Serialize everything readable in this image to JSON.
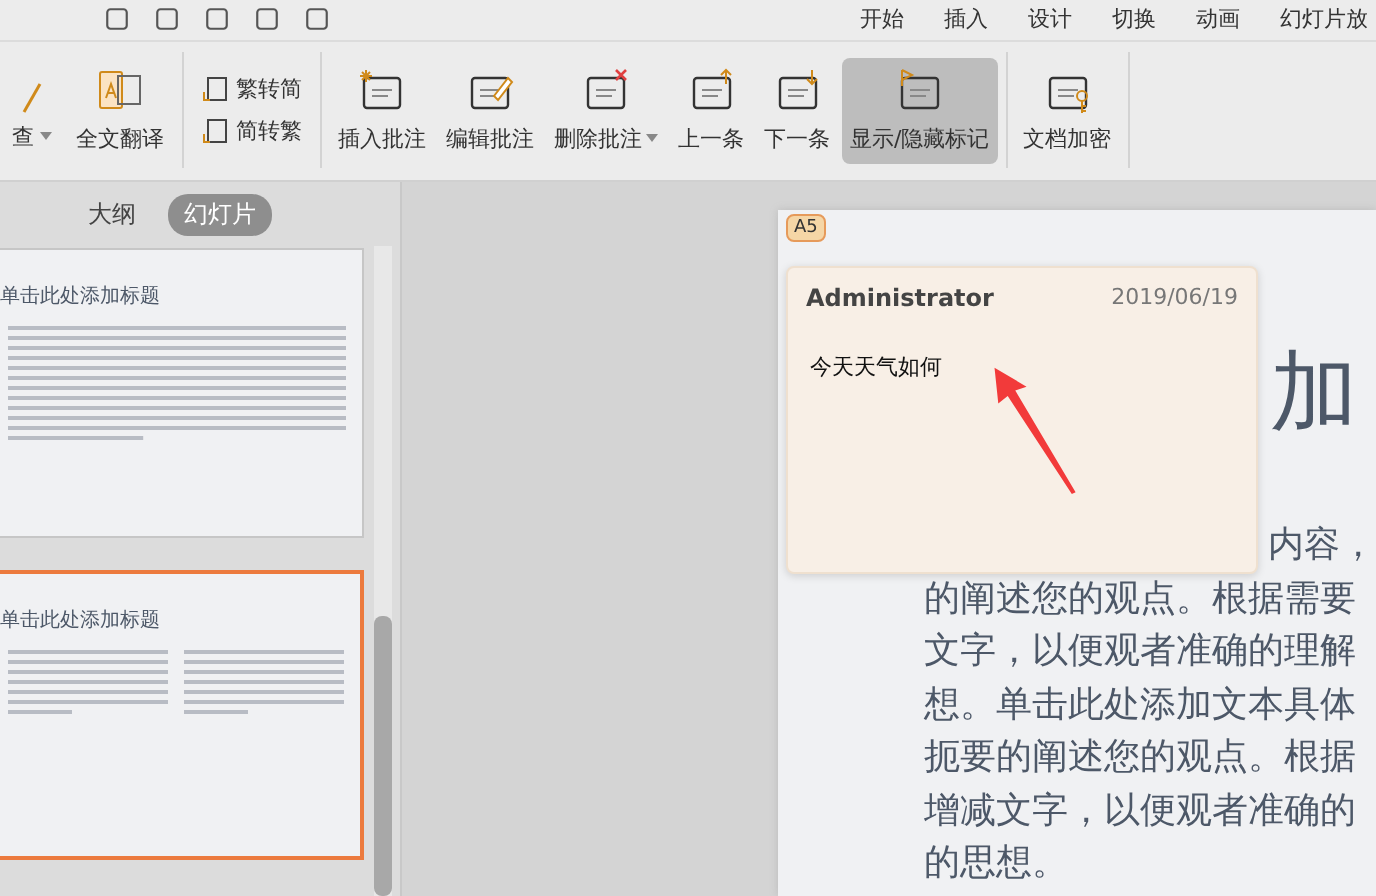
{
  "menu_tabs": [
    "开始",
    "插入",
    "设计",
    "切换",
    "动画",
    "幻灯片放"
  ],
  "ribbon": {
    "left_label": "查",
    "translate": "全文翻译",
    "convert": [
      "繁转简",
      "简转繁"
    ],
    "tools": [
      {
        "label": "插入批注",
        "kind": "insert",
        "selected": false,
        "dropdown": false
      },
      {
        "label": "编辑批注",
        "kind": "edit",
        "selected": false,
        "dropdown": false
      },
      {
        "label": "删除批注",
        "kind": "delete",
        "selected": false,
        "dropdown": true
      },
      {
        "label": "上一条",
        "kind": "prev",
        "selected": false,
        "dropdown": false
      },
      {
        "label": "下一条",
        "kind": "next",
        "selected": false,
        "dropdown": false
      },
      {
        "label": "显示/隐藏标记",
        "kind": "markup",
        "selected": true,
        "dropdown": false
      },
      {
        "label": "文档加密",
        "kind": "encrypt",
        "selected": false,
        "dropdown": false
      }
    ]
  },
  "side_tabs": [
    {
      "label": "大纲",
      "selected": false
    },
    {
      "label": "幻灯片",
      "selected": true
    }
  ],
  "thumbnails": [
    {
      "title": "单击此处添加标题",
      "kind": "single",
      "selected": false
    },
    {
      "title": "单击此处添加标题",
      "kind": "double",
      "selected": true
    }
  ],
  "slide": {
    "title": "加",
    "body": [
      "内容，",
      "的阐述您的观点。根据需要",
      "文字，以便观者准确的理解",
      "想。单击此处添加文本具体",
      "扼要的阐述您的观点。根据",
      "增减文字，以便观者准确的",
      "的思想。"
    ]
  },
  "comment": {
    "marker": "A5",
    "author": "Administrator",
    "date": "2019/06/19",
    "text": "今天天气如何"
  }
}
